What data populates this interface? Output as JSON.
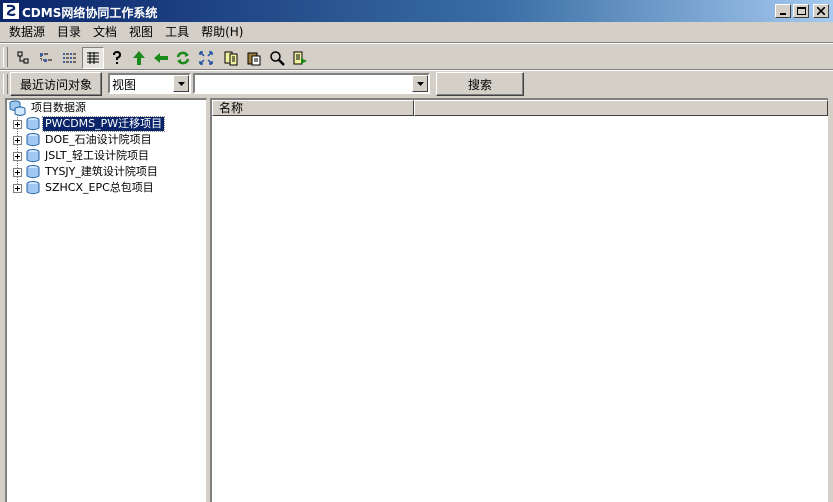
{
  "window": {
    "title": "CDMS网络协同工作系统",
    "controls": [
      "minimize",
      "maximize",
      "close"
    ]
  },
  "menubar": {
    "items": [
      {
        "label": "数据源"
      },
      {
        "label": "目录"
      },
      {
        "label": "文档"
      },
      {
        "label": "视图"
      },
      {
        "label": "工具"
      },
      {
        "label": "帮助(H)"
      }
    ]
  },
  "toolbar": {
    "buttons": [
      {
        "icon": "large-icons-view-icon"
      },
      {
        "icon": "small-icons-view-icon"
      },
      {
        "icon": "list-view-icon"
      },
      {
        "icon": "details-view-icon",
        "pressed": true
      },
      {
        "icon": "help-icon"
      },
      {
        "icon": "up-arrow-icon"
      },
      {
        "icon": "back-arrow-icon"
      },
      {
        "icon": "refresh-icon"
      },
      {
        "icon": "expand-icon"
      },
      {
        "icon": "copy-icon"
      },
      {
        "icon": "paste-icon"
      },
      {
        "icon": "search-icon"
      },
      {
        "icon": "export-icon"
      }
    ]
  },
  "addressbar": {
    "recent_button": "最近访问对象",
    "view_select": "视图",
    "path_select": "",
    "search_button": "搜索"
  },
  "tree": {
    "root": "项目数据源",
    "items": [
      {
        "label": "PWCDMS_PW迁移项目",
        "selected": true
      },
      {
        "label": "DOE_石油设计院项目",
        "selected": false
      },
      {
        "label": "JSLT_轻工设计院项目",
        "selected": false
      },
      {
        "label": "TYSJY_建筑设计院项目",
        "selected": false
      },
      {
        "label": "SZHCX_EPC总包项目",
        "selected": false
      }
    ]
  },
  "list": {
    "columns": [
      "名称",
      ""
    ]
  },
  "colors": {
    "title_bar": "#0a246a",
    "face": "#d4d0c8",
    "selection": "#0a246a"
  }
}
